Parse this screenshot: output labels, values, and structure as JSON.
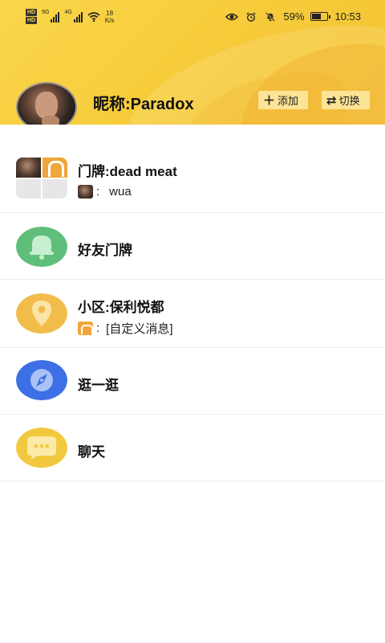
{
  "status": {
    "net_type": "5G",
    "net_type2": "4G",
    "hd1": "HD",
    "hd2": "HD",
    "speed_value": "18",
    "speed_unit": "K/s",
    "battery": "59%",
    "time": "10:53"
  },
  "header": {
    "nickname": "昵称:Paradox",
    "add_label": "添加",
    "switch_label": "切换",
    "add_icon": "plus-icon",
    "switch_icon": "swap-icon"
  },
  "list": [
    {
      "title": "门牌:dead meat",
      "sub_sep": ":",
      "sub_text": "wua",
      "icon": "doorplate-group-icon"
    },
    {
      "title": "好友门牌",
      "icon": "bell-icon",
      "color": "#5fbf7a"
    },
    {
      "title": "小区:保利悦都",
      "sub_sep": ":",
      "sub_text": "[自定义消息]",
      "icon": "location-pin-icon",
      "color": "#f2bc4a"
    },
    {
      "title": "逛一逛",
      "icon": "compass-icon",
      "color": "#3d6fe6"
    },
    {
      "title": "聊天",
      "icon": "chat-bubble-icon",
      "color": "#f2c93e"
    }
  ]
}
